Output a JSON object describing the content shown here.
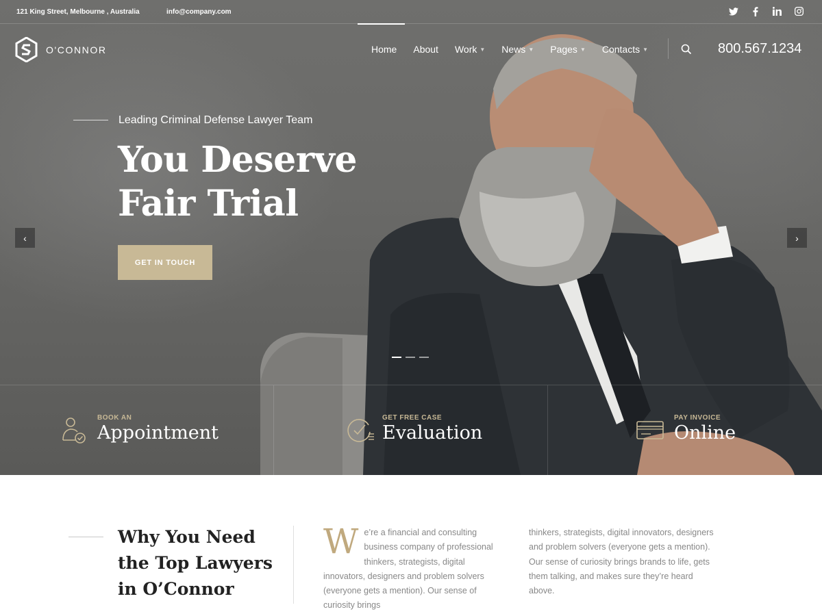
{
  "topbar": {
    "address": "121 King Street, Melbourne , Australia",
    "email": "info@company.com",
    "socials": [
      "twitter-icon",
      "facebook-icon",
      "linkedin-icon",
      "instagram-icon"
    ]
  },
  "brand": {
    "name": "O'CONNOR"
  },
  "nav": {
    "items": [
      {
        "label": "Home",
        "active": true
      },
      {
        "label": "About"
      },
      {
        "label": "Work",
        "dropdown": true
      },
      {
        "label": "News",
        "dropdown": true
      },
      {
        "label": "Pages",
        "dropdown": true
      },
      {
        "label": "Contacts",
        "dropdown": true
      }
    ],
    "phone": "800.567.1234"
  },
  "hero": {
    "tagline": "Leading Criminal Defense Lawyer Team",
    "headline_line1": "You Deserve",
    "headline_line2": "Fair Trial",
    "cta": "GET IN TOUCH",
    "slides": 3,
    "current_slide": 1
  },
  "features": [
    {
      "small": "BOOK AN",
      "big": "Appointment",
      "icon": "user-check-icon"
    },
    {
      "small": "GET FREE CASE",
      "big": "Evaluation",
      "icon": "clock-check-icon"
    },
    {
      "small": "PAY INVOICE",
      "big": "Online",
      "icon": "credit-card-icon"
    }
  ],
  "intro": {
    "title": "Why You Need the Top Lawyers in O’Connor",
    "dropcap": "W",
    "col1": "e’re a financial and consulting business company of professional thinkers, strategists, digital innovators, designers and problem solvers (everyone gets a mention). Our sense of curiosity brings",
    "col2": "thinkers, strategists, digital innovators, designers and problem solvers (everyone gets a mention). Our sense of curiosity brings brands to life, gets them talking, and makes sure they’re heard above."
  },
  "colors": {
    "accent": "#c8b996",
    "dropcap": "#c0a97e",
    "hero_bg": "#6a6a68"
  }
}
